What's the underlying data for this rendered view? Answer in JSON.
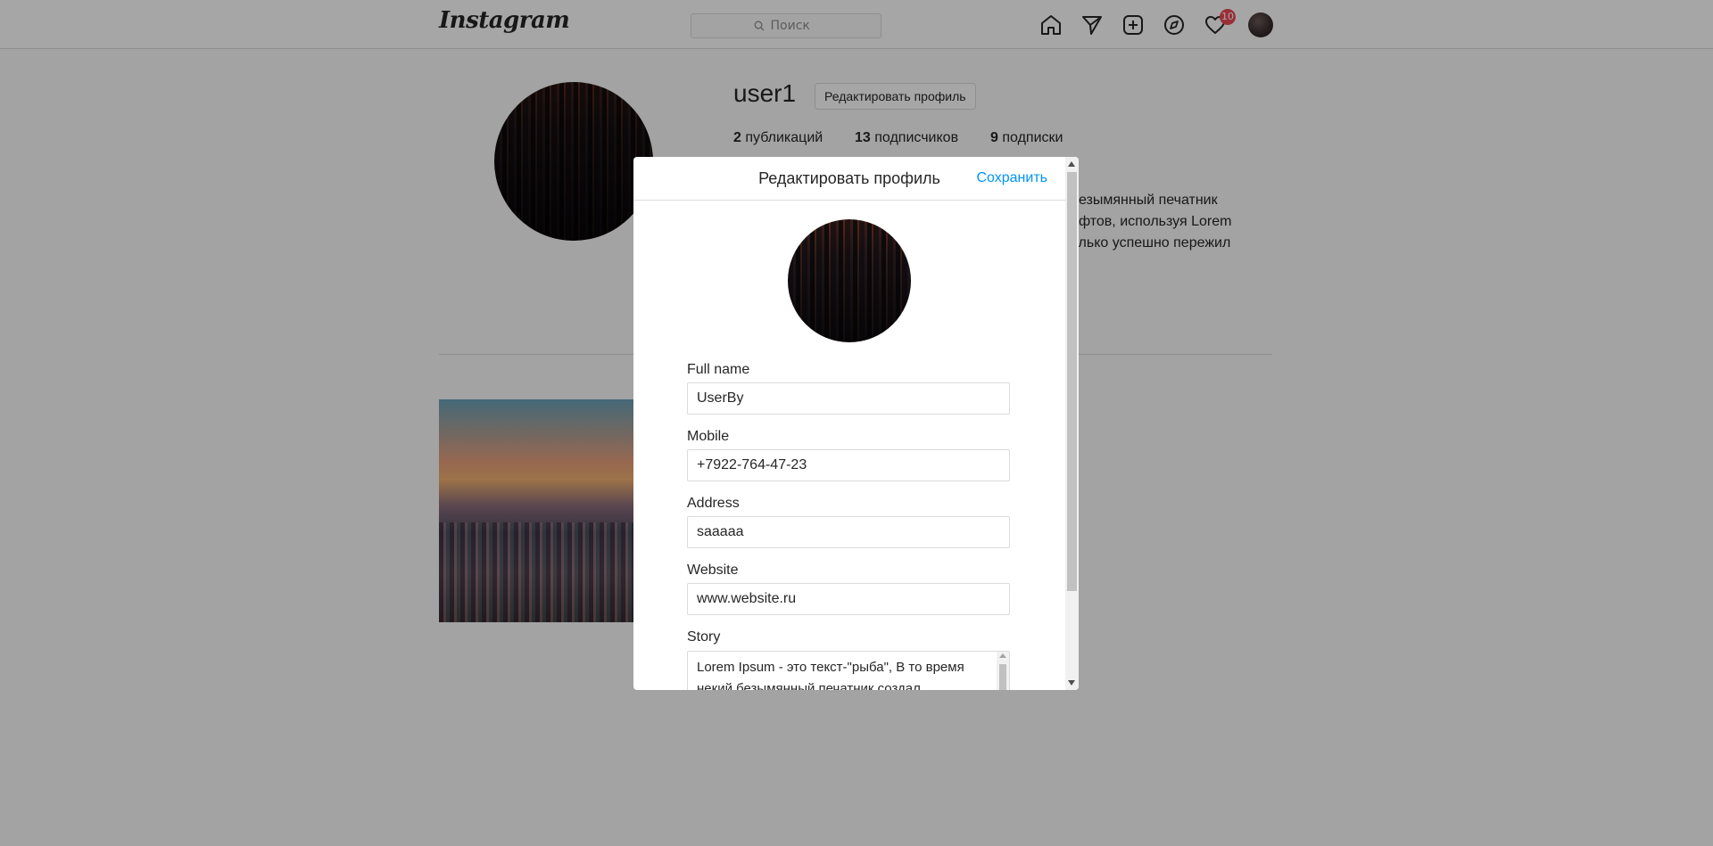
{
  "nav": {
    "logo": "Instagram",
    "search_placeholder": "Поиск",
    "notifications_count": "10",
    "icons": [
      "home-icon",
      "direct-icon",
      "new-post-icon",
      "explore-icon",
      "heart-icon"
    ]
  },
  "profile": {
    "username": "user1",
    "edit_button": "Редактировать профиль",
    "posts_count": "2",
    "posts_label": "публикаций",
    "followers_count": "13",
    "followers_label": "подписчиков",
    "following_count": "9",
    "following_label": "подписки",
    "bio_lines": [
      "безымянный печатник",
      "ифтов, используя Lorem",
      "олько успешно пережил"
    ]
  },
  "modal": {
    "title": "Редактировать профиль",
    "save_label": "Сохранить",
    "fields": {
      "full_name": {
        "label": "Full name",
        "value": "UserBy"
      },
      "mobile": {
        "label": "Mobile",
        "value": "+7922-764-47-23"
      },
      "address": {
        "label": "Address",
        "value": "saaaaa"
      },
      "website": {
        "label": "Website",
        "value": "www.website.ru"
      },
      "story": {
        "label": "Story",
        "value": "Lorem Ipsum - это текст-\"рыба\", В то время некий безымянный печатник создал"
      }
    }
  },
  "colors": {
    "accent": "#0095f6",
    "badge": "#ed4956",
    "border": "#dbdbdb",
    "overlay": "rgba(0,0,0,0.35)"
  }
}
